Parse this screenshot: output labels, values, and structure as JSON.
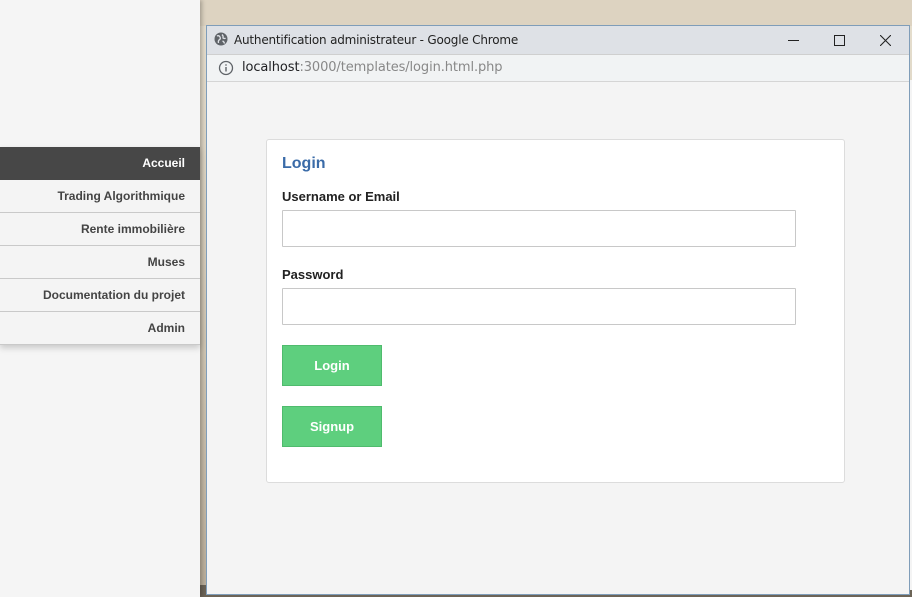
{
  "site_menu": {
    "items": [
      {
        "label": "Accueil",
        "active": true
      },
      {
        "label": "Trading Algorithmique",
        "active": false
      },
      {
        "label": "Rente immobilière",
        "active": false
      },
      {
        "label": "Muses",
        "active": false
      },
      {
        "label": "Documentation du projet",
        "active": false
      },
      {
        "label": "Admin",
        "active": false
      }
    ]
  },
  "popup": {
    "title": "Authentification administrateur - Google Chrome",
    "url_host": "localhost",
    "url_path": ":3000/templates/login.html.php",
    "icons": {
      "title": "globe-icon",
      "address": "info-icon",
      "minimize": "minimize-icon",
      "maximize": "maximize-icon",
      "close": "close-icon"
    }
  },
  "login_form": {
    "heading": "Login",
    "username_label": "Username or Email",
    "username_value": "",
    "password_label": "Password",
    "password_value": "",
    "login_button": "Login",
    "signup_button": "Signup"
  },
  "colors": {
    "menu_active_bg": "#474747",
    "heading": "#3a6ba8",
    "button_green": "#5ecf7e"
  }
}
